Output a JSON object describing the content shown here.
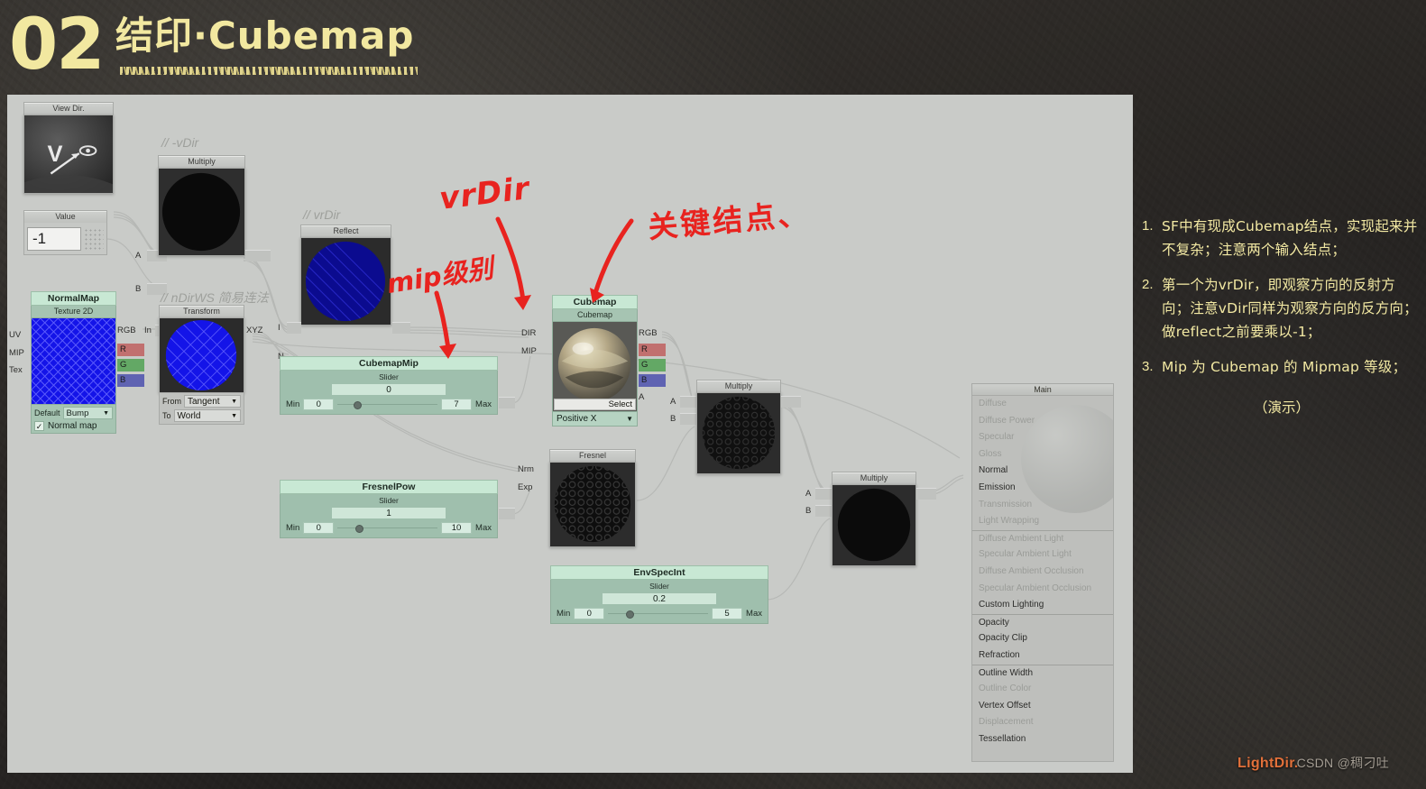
{
  "header": {
    "number": "02",
    "title": "结印·Cubemap"
  },
  "notes": {
    "items": [
      {
        "num": "1.",
        "text": "SF中有现成Cubemap结点，实现起来并不复杂；注意两个输入结点；"
      },
      {
        "num": "2.",
        "text": "第一个为vrDir，即观察方向的反射方向；注意vDir同样为观察方向的反方向；做reflect之前要乘以-1；"
      },
      {
        "num": "3.",
        "text": "Mip 为 Cubemap 的 Mipmap 等级；"
      }
    ],
    "demo": "（演示）"
  },
  "watermark": {
    "text": "LightDir.",
    "csdn": "CSDN @稠刁吐"
  },
  "annotations": {
    "vrdir": "vrDir",
    "mip": "mip级别",
    "key_node": "关键结点、"
  },
  "comments": {
    "vdir_neg": "// -vDir",
    "vrdir": "// vrDir",
    "ndirws": "// nDirWS 简易连法"
  },
  "nodes": {
    "view_dir": {
      "title": "View Dir.",
      "out_ports": []
    },
    "value": {
      "title": "Value",
      "value": "-1"
    },
    "multiply1": {
      "title": "Multiply",
      "in_a": "A",
      "in_b": "B"
    },
    "normalmap": {
      "name": "NormalMap",
      "subtitle": "Texture 2D",
      "in_ports": [
        "UV",
        "MIP",
        "Tex"
      ],
      "out_ports": [
        "RGB",
        "R",
        "G",
        "B"
      ],
      "default_label": "Default",
      "default_value": "Bump",
      "checkbox_label": "Normal map",
      "checkbox_checked": true
    },
    "transform": {
      "title": "Transform",
      "in_port": "In",
      "out_port": "XYZ",
      "from_label": "From",
      "from_value": "Tangent",
      "to_label": "To",
      "to_value": "World"
    },
    "reflect": {
      "title": "Reflect",
      "in_ports": [
        "I",
        "N"
      ]
    },
    "cubemapmip": {
      "name": "CubemapMip",
      "sub": "Slider",
      "value": "0",
      "min_label": "Min",
      "min": "0",
      "max": "7",
      "max_label": "Max"
    },
    "fresnelpow": {
      "name": "FresnelPow",
      "sub": "Slider",
      "value": "1",
      "min_label": "Min",
      "min": "0",
      "max": "10",
      "max_label": "Max"
    },
    "envspecint": {
      "name": "EnvSpecInt",
      "sub": "Slider",
      "value": "0.2",
      "min_label": "Min",
      "min": "0",
      "max": "5",
      "max_label": "Max"
    },
    "cubemap": {
      "name": "Cubemap",
      "subtitle": "Cubemap",
      "in_ports": [
        "DIR",
        "MIP"
      ],
      "out_ports": [
        "RGB",
        "R",
        "G",
        "B",
        "A"
      ],
      "select_button": "Select",
      "face_value": "Positive X"
    },
    "fresnel": {
      "title": "Fresnel",
      "in_ports": [
        "Nrm",
        "Exp"
      ]
    },
    "multiply2": {
      "title": "Multiply",
      "in_a": "A",
      "in_b": "B"
    },
    "multiply3": {
      "title": "Multiply",
      "in_a": "A",
      "in_b": "B"
    },
    "main": {
      "title": "Main",
      "slots": [
        {
          "label": "Diffuse",
          "enabled": false
        },
        {
          "label": "Diffuse Power",
          "enabled": false
        },
        {
          "label": "Specular",
          "enabled": false
        },
        {
          "label": "Gloss",
          "enabled": false
        },
        {
          "label": "Normal",
          "enabled": true
        },
        {
          "label": "Emission",
          "enabled": true
        },
        {
          "label": "Transmission",
          "enabled": false
        },
        {
          "label": "Light Wrapping",
          "enabled": false
        },
        {
          "label": "Diffuse Ambient Light",
          "enabled": false,
          "sep": true
        },
        {
          "label": "Specular Ambient Light",
          "enabled": false
        },
        {
          "label": "Diffuse Ambient Occlusion",
          "enabled": false
        },
        {
          "label": "Specular Ambient Occlusion",
          "enabled": false
        },
        {
          "label": "Custom Lighting",
          "enabled": true
        },
        {
          "label": "Opacity",
          "enabled": true,
          "sep": true
        },
        {
          "label": "Opacity Clip",
          "enabled": true
        },
        {
          "label": "Refraction",
          "enabled": true
        },
        {
          "label": "Outline Width",
          "enabled": true,
          "sep": true
        },
        {
          "label": "Outline Color",
          "enabled": false
        },
        {
          "label": "Vertex Offset",
          "enabled": true
        },
        {
          "label": "Displacement",
          "enabled": false
        },
        {
          "label": "Tessellation",
          "enabled": true
        }
      ]
    }
  },
  "colors": {
    "accent_yellow": "#f3e9a3",
    "annotation_red": "#e8231f",
    "node_green": "#c8e8d4",
    "canvas": "#c9cbc8",
    "channel_r": "#c1706f",
    "channel_g": "#63a865",
    "channel_b": "#5f63b2"
  }
}
